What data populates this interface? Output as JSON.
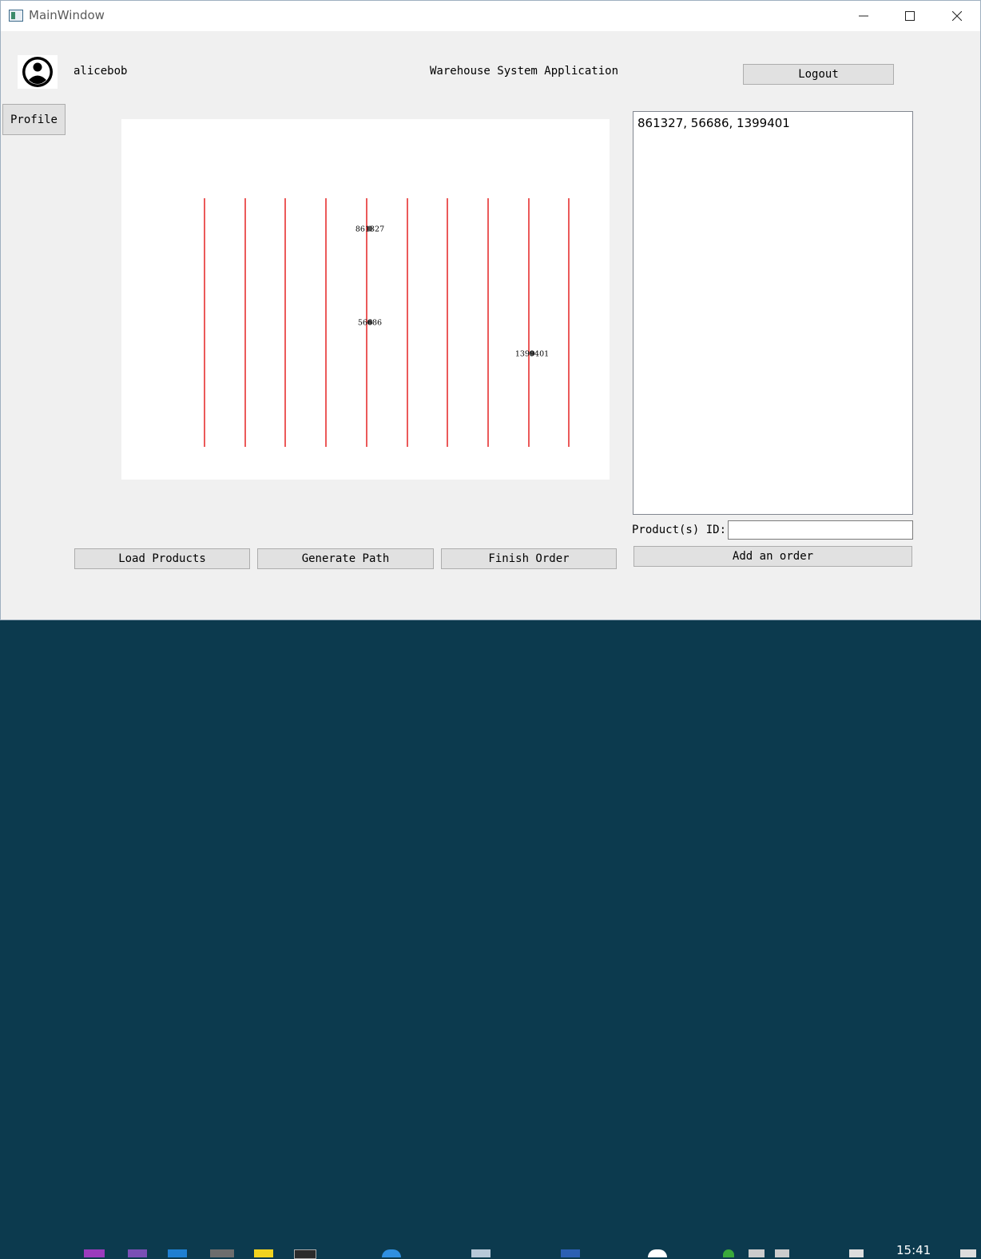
{
  "window": {
    "title": "MainWindow",
    "icon": "app-window-icon",
    "controls": [
      "minimize-icon",
      "maximize-icon",
      "close-icon"
    ]
  },
  "header": {
    "username": "alicebob",
    "app_title": "Warehouse System Application",
    "logout_label": "Logout",
    "profile_label": "Profile",
    "avatar_icon": "user-avatar-icon"
  },
  "map": {
    "accent": "#e00000",
    "products": [
      {
        "label": "861327"
      },
      {
        "label": "56686"
      },
      {
        "label": "1399401"
      }
    ]
  },
  "order_list": {
    "items": [
      "861327, 56686, 1399401"
    ]
  },
  "product_input": {
    "label": "Product(s) ID:",
    "value": ""
  },
  "buttons": {
    "load_products": "Load Products",
    "generate_path": "Generate Path",
    "finish_order": "Finish Order",
    "add_order": "Add an order"
  },
  "taskbar": {
    "time": "15:41"
  }
}
